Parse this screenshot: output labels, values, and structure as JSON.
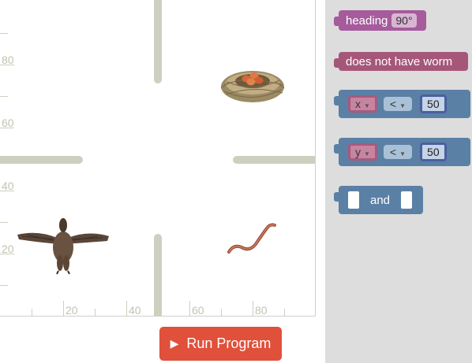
{
  "stage": {
    "y_labels": [
      "80",
      "60",
      "40",
      "20"
    ],
    "x_labels": [
      "20",
      "40",
      "60",
      "80"
    ]
  },
  "run_button": {
    "label": "Run Program"
  },
  "toolbox": {
    "heading_block": {
      "label": "heading",
      "value": "90°",
      "color": "#a55b9c"
    },
    "worm_block": {
      "label": "does not have worm",
      "color": "#a5577a"
    },
    "compare_x_block": {
      "variable": "x",
      "operator": "<",
      "value": "50",
      "color": "#5b80a5"
    },
    "compare_y_block": {
      "variable": "y",
      "operator": "<",
      "value": "50",
      "color": "#5b80a5"
    },
    "and_block": {
      "label": "and",
      "color": "#5b80a5"
    }
  },
  "icons": [
    "nest-eggs-icon",
    "duck-icon",
    "worm-icon",
    "play-icon",
    "chevron-down-icon"
  ],
  "colors": {
    "run_button": "#e0503a",
    "wall": "#cfcfc0",
    "toolbox_bg": "#dddddd"
  }
}
